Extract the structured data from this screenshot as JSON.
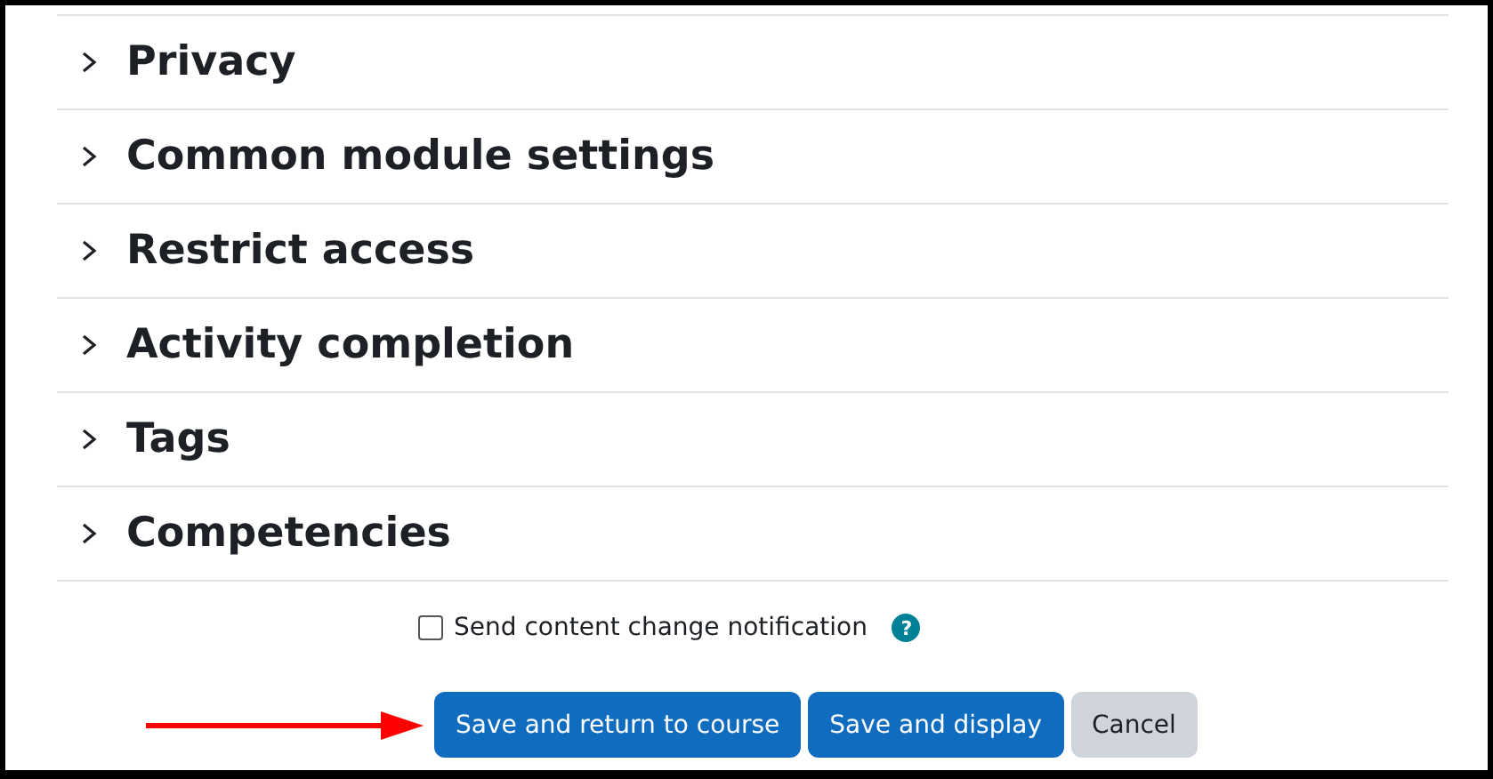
{
  "sections": [
    {
      "title": "Privacy",
      "expanded": false
    },
    {
      "title": "Common module settings",
      "expanded": false
    },
    {
      "title": "Restrict access",
      "expanded": false
    },
    {
      "title": "Activity completion",
      "expanded": false
    },
    {
      "title": "Tags",
      "expanded": false
    },
    {
      "title": "Competencies",
      "expanded": false
    }
  ],
  "notification": {
    "label": "Send content change notification",
    "checked": false,
    "help": "?"
  },
  "buttons": [
    {
      "label": "Save and return to course",
      "kind": "primary"
    },
    {
      "label": "Save and display",
      "kind": "primary"
    },
    {
      "label": "Cancel",
      "kind": "secondary"
    }
  ]
}
